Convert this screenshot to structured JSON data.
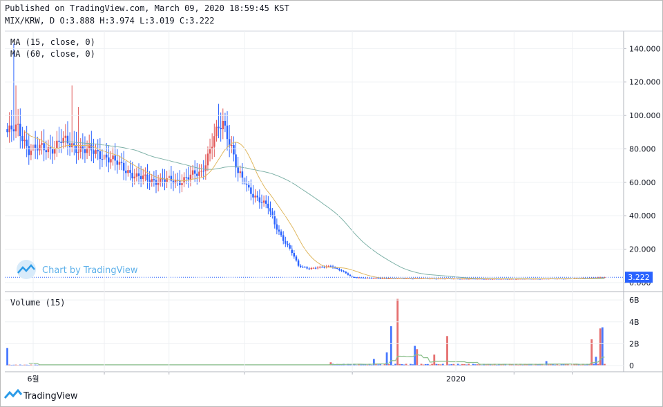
{
  "header": {
    "published": "Published on TradingView.com, March 09, 2020 18:59:45 KST",
    "symbol": "MIX/KRW, D",
    "ohlc": {
      "o": "3.888",
      "h": "3.974",
      "l": "3.019",
      "c": "3.222"
    },
    "ohlc_line": "MIX/KRW, D O:3.888 H:3.974 L:3.019 C:3.222"
  },
  "legend": {
    "ma15": "MA (15, close, 0)",
    "ma60": "MA (60, close, 0)",
    "volume": "Volume (15)"
  },
  "watermark": "Chart by TradingView",
  "footer_logo": "TradingView",
  "last_price": "3.222",
  "colors": {
    "up": "#e05656",
    "down": "#2962ff",
    "ma15": "#e0b860",
    "ma60": "#7fb2a8",
    "vol_ma": "#8bbf8b",
    "price_line": "#2962ff",
    "grid": "#eef0f3"
  },
  "chart_data": {
    "type": "candlestick",
    "price_axis": {
      "ticks": [
        "140.000",
        "120.000",
        "100.000",
        "80.000",
        "60.000",
        "40.000",
        "20.000",
        "0.000"
      ],
      "ylim": [
        0,
        148
      ]
    },
    "volume_axis": {
      "ticks": [
        "6B",
        "4B",
        "2B",
        "0"
      ],
      "ylim": [
        0,
        6.2
      ]
    },
    "x_ticks": [
      "6월",
      "2020"
    ],
    "close_profile": [
      [
        0,
        90
      ],
      [
        5,
        92
      ],
      [
        10,
        80
      ],
      [
        20,
        80
      ],
      [
        25,
        85
      ],
      [
        30,
        82
      ],
      [
        35,
        80
      ],
      [
        40,
        78
      ],
      [
        45,
        76
      ],
      [
        50,
        72
      ],
      [
        55,
        68
      ],
      [
        60,
        63
      ],
      [
        65,
        62
      ],
      [
        70,
        61
      ],
      [
        75,
        61
      ],
      [
        80,
        61
      ],
      [
        84,
        63
      ],
      [
        90,
        66
      ],
      [
        96,
        87
      ],
      [
        100,
        95
      ],
      [
        104,
        82
      ],
      [
        107,
        66
      ],
      [
        112,
        55
      ],
      [
        117,
        50
      ],
      [
        121,
        45
      ],
      [
        124,
        35
      ],
      [
        128,
        26
      ],
      [
        132,
        18
      ],
      [
        135,
        10
      ],
      [
        140,
        8.5
      ],
      [
        145,
        9
      ],
      [
        150,
        10
      ],
      [
        155,
        7
      ],
      [
        160,
        3.2
      ],
      [
        170,
        2.6
      ],
      [
        200,
        2.4
      ],
      [
        230,
        2.2
      ],
      [
        260,
        2.4
      ],
      [
        277,
        3.222
      ]
    ],
    "volume_spikes": [
      {
        "day": 0,
        "v": 1.6,
        "dir": "down"
      },
      {
        "day": 150,
        "v": 0.3,
        "dir": "up"
      },
      {
        "day": 170,
        "v": 0.6,
        "dir": "down"
      },
      {
        "day": 176,
        "v": 1.2,
        "dir": "down"
      },
      {
        "day": 178,
        "v": 3.6,
        "dir": "down"
      },
      {
        "day": 181,
        "v": 6.1,
        "dir": "up"
      },
      {
        "day": 189,
        "v": 1.8,
        "dir": "down"
      },
      {
        "day": 190,
        "v": 1.5,
        "dir": "up"
      },
      {
        "day": 198,
        "v": 1.0,
        "dir": "up"
      },
      {
        "day": 204,
        "v": 2.7,
        "dir": "up"
      },
      {
        "day": 250,
        "v": 0.4,
        "dir": "down"
      },
      {
        "day": 271,
        "v": 2.4,
        "dir": "up"
      },
      {
        "day": 273,
        "v": 0.8,
        "dir": "down"
      },
      {
        "day": 275,
        "v": 3.4,
        "dir": "up"
      },
      {
        "day": 276,
        "v": 3.5,
        "dir": "down"
      }
    ],
    "days": 278,
    "grid": true
  }
}
